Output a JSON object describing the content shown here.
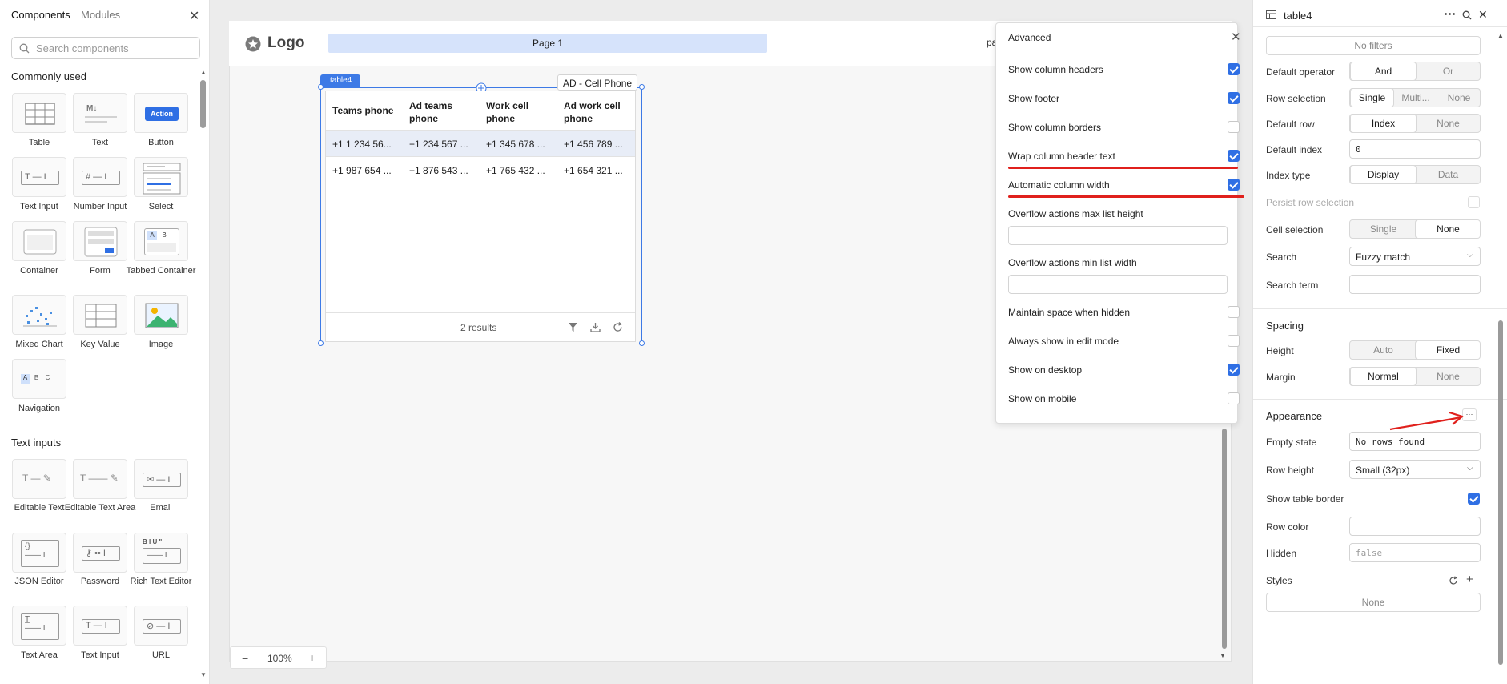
{
  "left_panel": {
    "tabs": [
      "Components",
      "Modules"
    ],
    "search_placeholder": "Search components",
    "sections": {
      "common": "Commonly used",
      "text_inputs": "Text inputs"
    },
    "common_items": [
      "Table",
      "Text",
      "Button",
      "Text Input",
      "Number Input",
      "Select",
      "Container",
      "Form",
      "Tabbed Container",
      "Mixed Chart",
      "Key Value",
      "Image",
      "Navigation"
    ],
    "text_input_items": [
      "Editable Text",
      "Editable Text Area",
      "Email",
      "JSON Editor",
      "Password",
      "Rich Text Editor",
      "Text Area",
      "Text Input",
      "URL"
    ],
    "button_tile_text": "Action",
    "tab_tile_text": [
      "A",
      "B"
    ],
    "nav_tile_text": [
      "A",
      "B",
      "C"
    ],
    "text_tile_mark": "T",
    "number_tile_mark": "#",
    "markdown_tile_mark": "M↓",
    "rte_tile_mark": "B I U \""
  },
  "canvas": {
    "logo": "Logo",
    "page_tab": "Page 1",
    "header_cut_text": "pa",
    "table_tag": "table4",
    "column_tooltip": "AD - Cell Phone",
    "zoom": "100%",
    "zoom_minus": "−",
    "zoom_plus": "+"
  },
  "table": {
    "headers": [
      [
        "Teams phone"
      ],
      [
        "Ad teams",
        "phone"
      ],
      [
        "Work cell",
        "phone"
      ],
      [
        "Ad work cell",
        "phone"
      ]
    ],
    "rows": [
      [
        "+1 1 234 56...",
        "+1 234 567 ...",
        "+1 345 678 ...",
        "+1 456 789 ..."
      ],
      [
        "+1 987 654 ...",
        "+1 876 543 ...",
        "+1 765 432 ...",
        "+1 654 321 ..."
      ]
    ],
    "footer": "2 results"
  },
  "advanced": {
    "title": "Advanced",
    "checks": [
      {
        "label": "Show column headers",
        "checked": true
      },
      {
        "label": "Show footer",
        "checked": true
      },
      {
        "label": "Show column borders",
        "checked": false
      },
      {
        "label": "Wrap column header text",
        "checked": true
      },
      {
        "label": "Automatic column width",
        "checked": true
      }
    ],
    "fields": [
      "Overflow actions max list height",
      "Overflow actions min list width"
    ],
    "checks2": [
      {
        "label": "Maintain space when hidden",
        "checked": false
      },
      {
        "label": "Always show in edit mode",
        "checked": false
      },
      {
        "label": "Show on desktop",
        "checked": true
      },
      {
        "label": "Show on mobile",
        "checked": false
      }
    ]
  },
  "right_panel": {
    "title": "table4",
    "no_filters": "No filters",
    "default_operator": {
      "label": "Default operator",
      "options": [
        "And",
        "Or"
      ]
    },
    "row_selection": {
      "label": "Row selection",
      "options": [
        "Single",
        "Multi...",
        "None"
      ]
    },
    "default_row": {
      "label": "Default row",
      "options": [
        "Index",
        "None"
      ]
    },
    "default_index": {
      "label": "Default index",
      "value": "0"
    },
    "index_type": {
      "label": "Index type",
      "options": [
        "Display",
        "Data"
      ]
    },
    "persist_row_selection": "Persist row selection",
    "cell_selection": {
      "label": "Cell selection",
      "options": [
        "Single",
        "None"
      ]
    },
    "search": {
      "label": "Search",
      "value": "Fuzzy match"
    },
    "search_term": "Search term",
    "spacing": "Spacing",
    "height": {
      "label": "Height",
      "options": [
        "Auto",
        "Fixed"
      ]
    },
    "margin": {
      "label": "Margin",
      "options": [
        "Normal",
        "None"
      ]
    },
    "appearance": "Appearance",
    "empty_state": {
      "label": "Empty state",
      "value": "No rows found"
    },
    "row_height": {
      "label": "Row height",
      "value": "Small (32px)"
    },
    "show_table_border": "Show table border",
    "row_color": "Row color",
    "hidden": {
      "label": "Hidden",
      "value": "false"
    },
    "styles": {
      "label": "Styles",
      "value": "None"
    }
  },
  "colors": {
    "accent": "#2f6fe4",
    "annotation": "#e0201c",
    "page_tab": "#d6e3fb"
  }
}
